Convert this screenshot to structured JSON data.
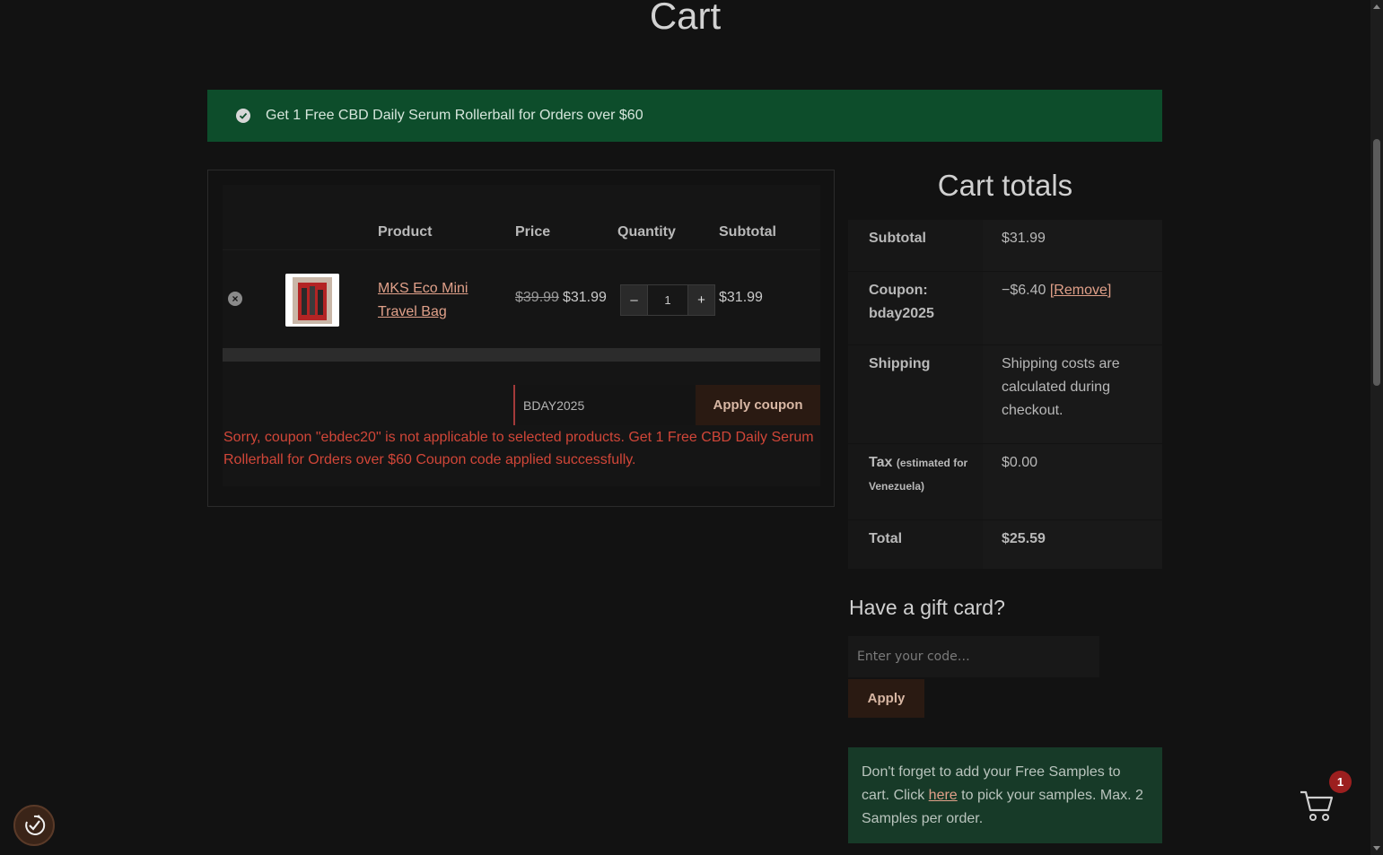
{
  "page": {
    "title": "Cart"
  },
  "notice": {
    "text": "Get 1 Free CBD Daily Serum Rollerball for Orders over $60"
  },
  "cart_table": {
    "headers": {
      "product": "Product",
      "price": "Price",
      "quantity": "Quantity",
      "subtotal": "Subtotal"
    },
    "items": [
      {
        "name": "MKS Eco Mini Travel Bag",
        "price_old": "$39.99",
        "price_new": "$31.99",
        "quantity": "1",
        "subtotal": "$31.99",
        "qty_minus": "–",
        "qty_plus": "+"
      }
    ]
  },
  "coupon": {
    "value": "BDAY2025",
    "apply_label": "Apply coupon",
    "error": "Sorry, coupon \"ebdec20\" is not applicable to selected products. Get 1 Free CBD Daily Serum Rollerball for Orders over $60 Coupon code applied successfully."
  },
  "totals": {
    "title": "Cart totals",
    "subtotal_label": "Subtotal",
    "subtotal_value": "$31.99",
    "coupon_label": "Coupon: bday2025",
    "coupon_value": "−$6.40",
    "coupon_remove": "[Remove]",
    "shipping_label": "Shipping",
    "shipping_value": "Shipping costs are calculated during checkout.",
    "tax_label": "Tax",
    "tax_note": "(estimated for Venezuela)",
    "tax_value": "$0.00",
    "total_label": "Total",
    "total_value": "$25.59"
  },
  "gift_card": {
    "title": "Have a gift card?",
    "placeholder": "Enter your code…",
    "apply_label": "Apply"
  },
  "samples_notice": {
    "before": "Don't forget to add your Free Samples to cart. Click ",
    "link": "here",
    "after": " to pick your samples. Max. 2 Samples per order."
  },
  "floating_cart": {
    "count": "1"
  },
  "colors": {
    "accent_green": "#0d4d2b",
    "link": "#e0a089",
    "error": "#d14638",
    "button_bg": "#2a1a12"
  }
}
